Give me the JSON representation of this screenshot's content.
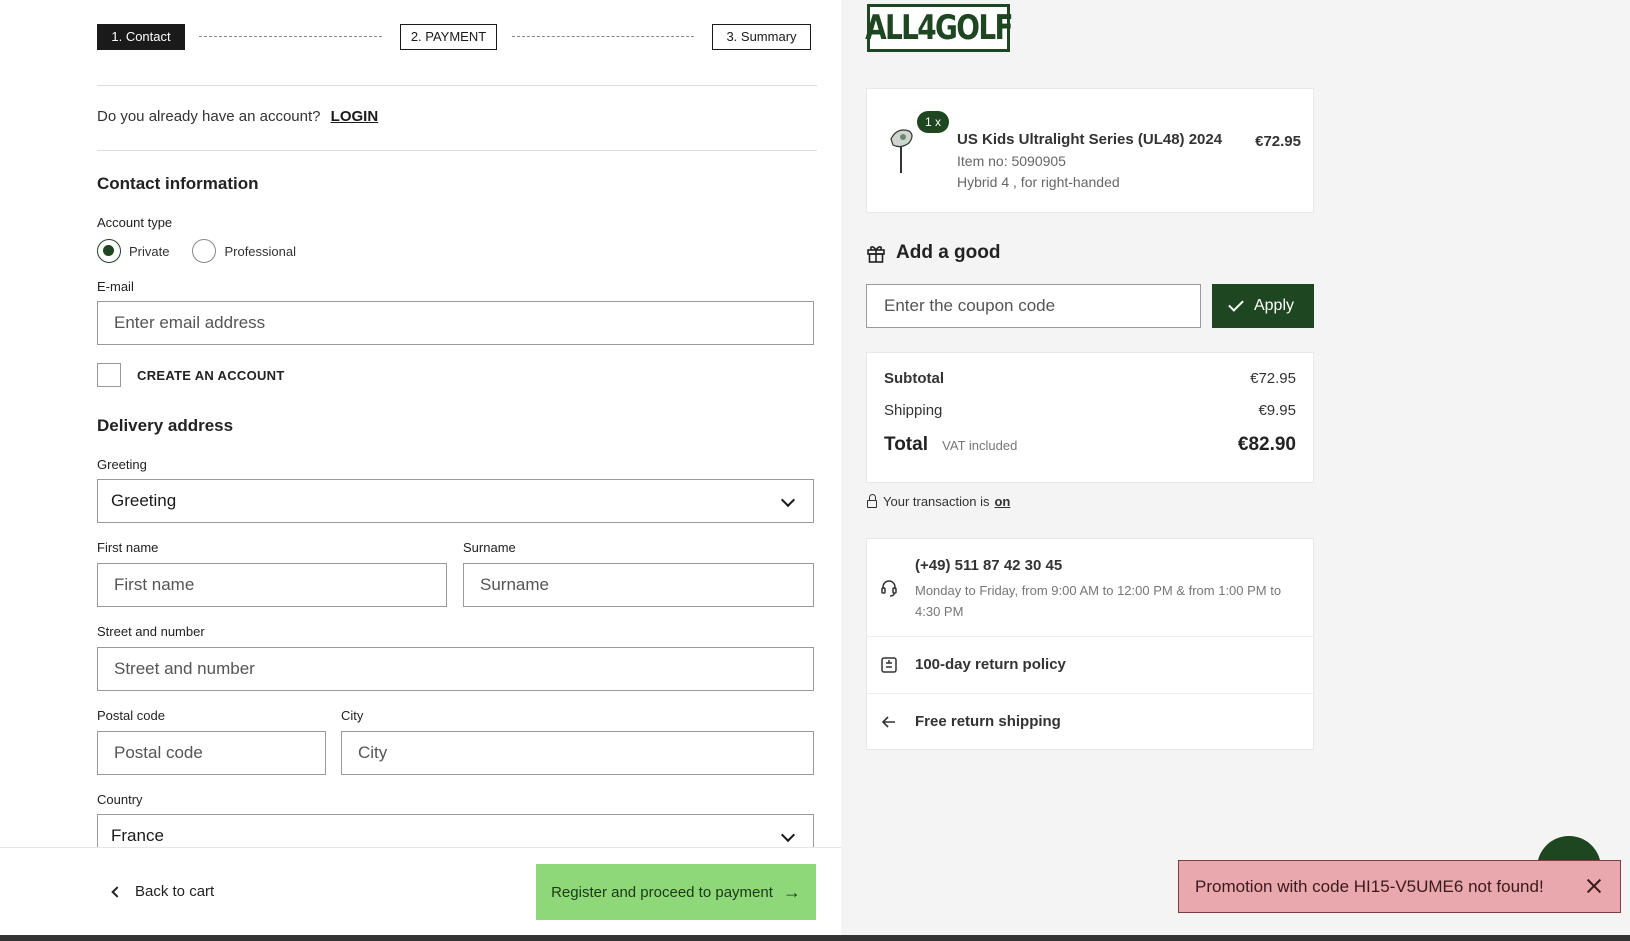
{
  "steps": [
    "1. Contact",
    "2. PAYMENT",
    "3. Summary"
  ],
  "login": {
    "question": "Do you already have an account?",
    "link": "LOGIN"
  },
  "contact": {
    "title": "Contact information",
    "account_type_label": "Account type",
    "options": [
      "Private",
      "Professional"
    ],
    "selected": "Private",
    "email_label": "E-mail",
    "email_placeholder": "Enter email address",
    "create_account": "CREATE AN ACCOUNT"
  },
  "delivery": {
    "title": "Delivery address",
    "greeting_label": "Greeting",
    "greeting_value": "Greeting",
    "first_name_label": "First name",
    "first_name_placeholder": "First name",
    "surname_label": "Surname",
    "surname_placeholder": "Surname",
    "street_label": "Street and number",
    "street_placeholder": "Street and number",
    "postal_label": "Postal code",
    "postal_placeholder": "Postal code",
    "city_label": "City",
    "city_placeholder": "City",
    "country_label": "Country",
    "country_value": "France"
  },
  "footer": {
    "back": "Back to cart",
    "proceed": "Register and proceed to payment"
  },
  "brand": {
    "logo": "ALL4GOLF",
    "color": "#1e4620"
  },
  "cart": {
    "qty": "1 x",
    "name": "US Kids Ultralight Series (UL48) 2024",
    "item_no": "Item no: 5090905",
    "variant": "Hybrid 4 , for right-handed",
    "price": "€72.95"
  },
  "coupon": {
    "heading": "Add a good",
    "placeholder": "Enter the coupon code",
    "button": "Apply"
  },
  "totals": {
    "subtotal_label": "Subtotal",
    "subtotal": "€72.95",
    "shipping_label": "Shipping",
    "shipping": "€9.95",
    "total_label": "Total",
    "vat": "VAT included",
    "total": "€82.90"
  },
  "secure": {
    "text": "Your transaction is",
    "state": "on"
  },
  "info": {
    "phone": "(+49) 511 87 42 30 45",
    "hours": "Monday to Friday, from 9:00 AM to 12:00 PM & from 1:00 PM to 4:30 PM",
    "returns": "100-day return policy",
    "free_returns": "Free return shipping"
  },
  "toast": {
    "message": "Promotion with code HI15-V5UME6 not found!",
    "color": "#e8a8ad"
  }
}
